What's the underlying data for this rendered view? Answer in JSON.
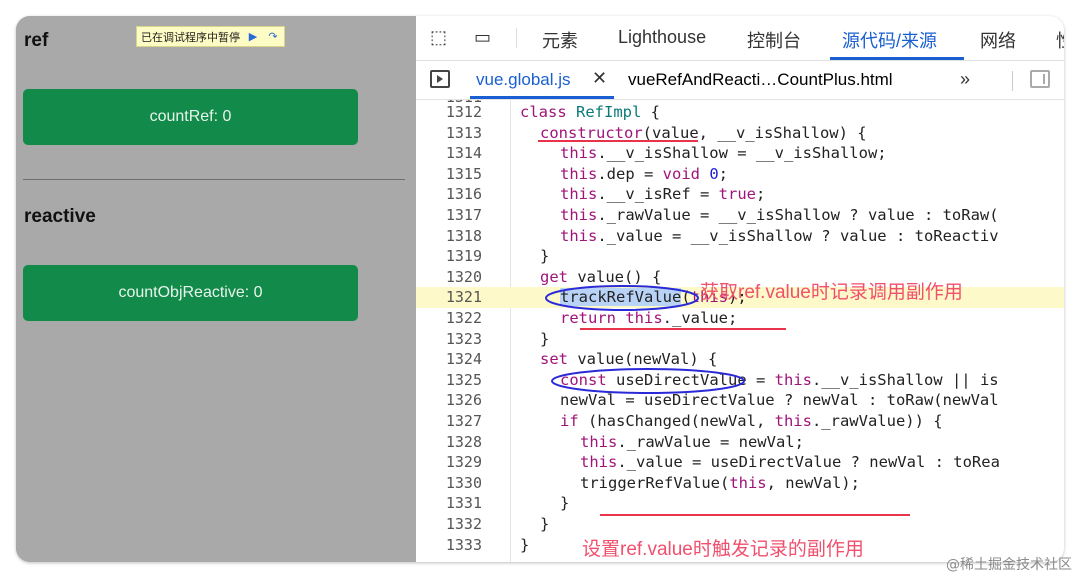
{
  "preview": {
    "paused_label": "已在调试程序中暂停",
    "ref_title": "ref",
    "ref_button": "countRef: 0",
    "reactive_title": "reactive",
    "reactive_button": "countObjReactive: 0"
  },
  "devtools": {
    "tabs": [
      "元素",
      "Lighthouse",
      "控制台",
      "源代码/来源",
      "网络",
      "性"
    ],
    "active_tab": "源代码/来源",
    "files": [
      "vue.global.js",
      "vueRefAndReacti…CountPlus.html"
    ],
    "active_file": "vue.global.js"
  },
  "code": {
    "first_line_partial": "1311",
    "lines": [
      {
        "no": "1312",
        "text": "class RefImpl {"
      },
      {
        "no": "1313",
        "text": "constructor(value, __v_isShallow) {"
      },
      {
        "no": "1314",
        "text": "this.__v_isShallow = __v_isShallow;"
      },
      {
        "no": "1315",
        "text": "this.dep = void 0;"
      },
      {
        "no": "1316",
        "text": "this.__v_isRef = true;"
      },
      {
        "no": "1317",
        "text": "this._rawValue = __v_isShallow ? value : toRaw("
      },
      {
        "no": "1318",
        "text": "this._value = __v_isShallow ? value : toReactiv"
      },
      {
        "no": "1319",
        "text": "}"
      },
      {
        "no": "1320",
        "text": "get value() {"
      },
      {
        "no": "1321",
        "text": "trackRefValue(this);"
      },
      {
        "no": "1322",
        "text": "return this._value;"
      },
      {
        "no": "1323",
        "text": "}"
      },
      {
        "no": "1324",
        "text": "set value(newVal) {"
      },
      {
        "no": "1325",
        "text": "const useDirectValue = this.__v_isShallow || is"
      },
      {
        "no": "1326",
        "text": "newVal = useDirectValue ? newVal : toRaw(newVal"
      },
      {
        "no": "1327",
        "text": "if (hasChanged(newVal, this._rawValue)) {"
      },
      {
        "no": "1328",
        "text": "this._rawValue = newVal;"
      },
      {
        "no": "1329",
        "text": "this._value = useDirectValue ? newVal : toRea"
      },
      {
        "no": "1330",
        "text": "triggerRefValue(this, newVal);"
      },
      {
        "no": "1331",
        "text": "}"
      },
      {
        "no": "1332",
        "text": "}"
      },
      {
        "no": "1333",
        "text": "}"
      }
    ],
    "highlighted_line": "1321"
  },
  "annotations": {
    "get_note": "获取ref.value时记录调用副作用",
    "set_note": "设置ref.value时触发记录的副作用"
  },
  "watermark": "@稀土掘金技术社区",
  "colors": {
    "preview_bg": "#a9a9a9",
    "button_green": "#128a4a",
    "active_blue": "#1a5fd1",
    "annotation_red": "#f0506e",
    "circle_blue": "#2a2ad8",
    "highlight_line": "#fdf9c8"
  }
}
